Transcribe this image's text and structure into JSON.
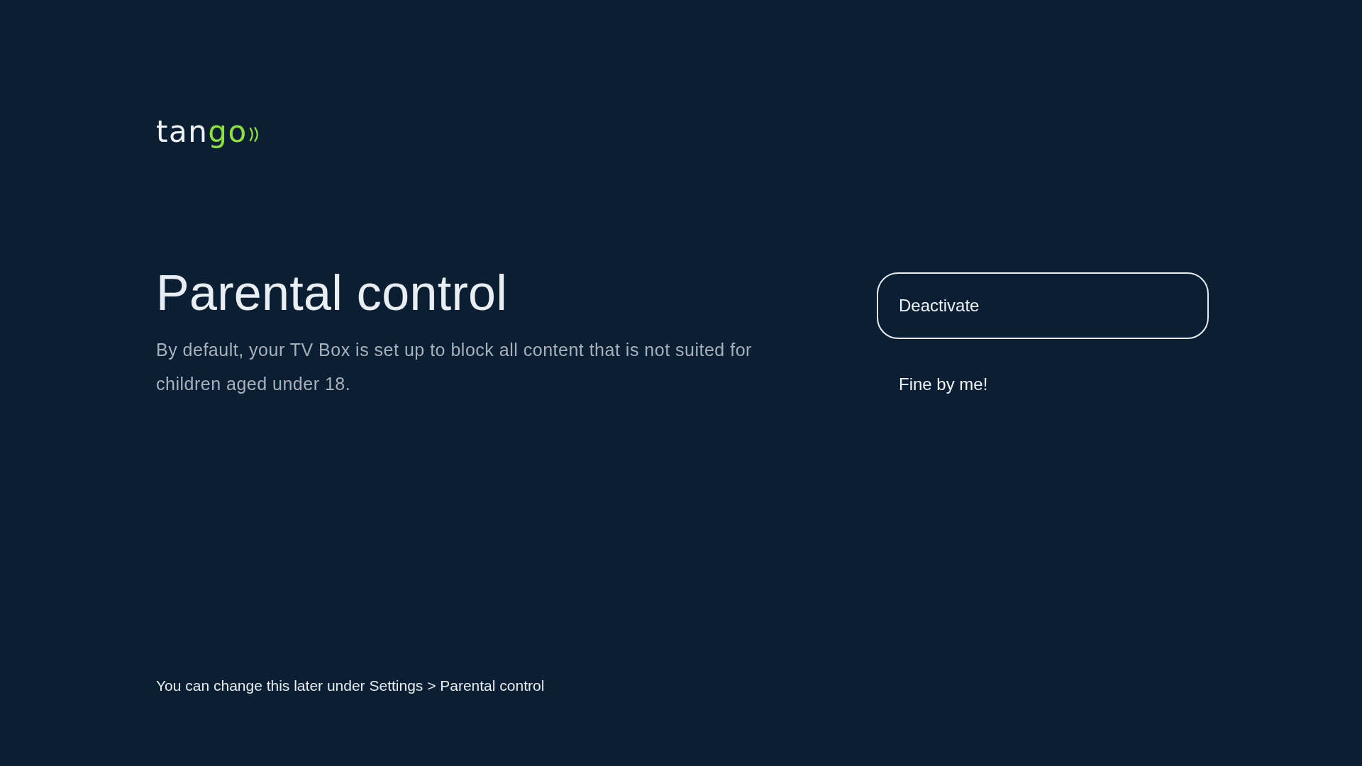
{
  "logo": {
    "parts": [
      {
        "text": "tan",
        "color": "#eef2f5"
      },
      {
        "text": "go",
        "color": "#8ee03c"
      }
    ]
  },
  "title": "Parental control",
  "description": "By default, your TV Box is set up to block all content that is not suited for children aged under 18.",
  "options": [
    {
      "label": "Deactivate",
      "selected": true
    },
    {
      "label": "Fine by me!",
      "selected": false
    }
  ],
  "footer_note": "You can change this later under Settings > Parental control"
}
